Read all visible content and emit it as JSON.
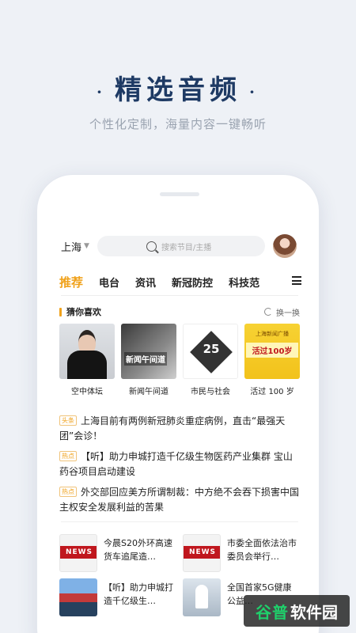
{
  "hero": {
    "title": "精选音频",
    "dot": "·",
    "subtitle": "个性化定制，海量内容一键畅听"
  },
  "topbar": {
    "city": "上海",
    "search_placeholder": "搜索节目/主播"
  },
  "tabs": [
    "推荐",
    "电台",
    "资讯",
    "新冠防控",
    "科技范"
  ],
  "guess": {
    "title": "猜你喜欢",
    "refresh": "换一换",
    "cards": [
      {
        "name": "空中体坛"
      },
      {
        "name": "新闻午间道",
        "thumb_text": "新闻午间道"
      },
      {
        "name": "市民与社会",
        "thumb_text": "25"
      },
      {
        "name": "活过 100 岁",
        "thumb_top": "上海新闻广播",
        "thumb_text": "活过100岁"
      }
    ]
  },
  "news": [
    {
      "tag": "头条",
      "text": "上海目前有两例新冠肺炎重症病例，直击“最强天团”会诊！"
    },
    {
      "tag": "热点",
      "text": "【听】助力申城打造千亿级生物医药产业集群 宝山药谷项目启动建设"
    },
    {
      "tag": "热点",
      "text": "外交部回应美方所谓制裁：中方绝不会吞下损害中国主权安全发展利益的苦果"
    }
  ],
  "videos": [
    {
      "title": "今晨S20外环高速货车追尾造…",
      "thumb_text": "NEWS"
    },
    {
      "title": "市委全面依法治市委员会举行…",
      "thumb_text": "NEWS"
    },
    {
      "title": "【听】助力申城打造千亿级生…"
    },
    {
      "title": "全国首家5G健康公益…"
    }
  ],
  "watermark": {
    "logo": "谷普",
    "text": "软件园"
  }
}
